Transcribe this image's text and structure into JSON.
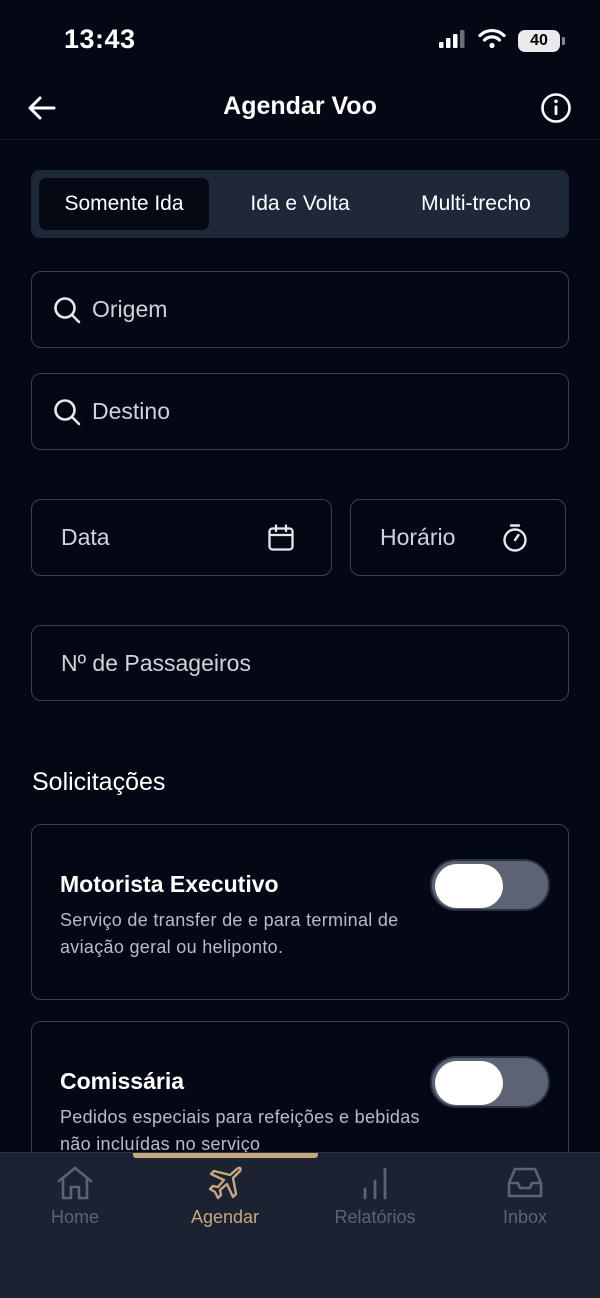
{
  "status": {
    "time": "13:43",
    "battery": "40"
  },
  "header": {
    "title": "Agendar Voo"
  },
  "trip_types": {
    "items": [
      "Somente Ida",
      "Ida e Volta",
      "Multi-trecho"
    ],
    "selected": "Somente Ida"
  },
  "form": {
    "origin_placeholder": "Origem",
    "destination_placeholder": "Destino",
    "date_placeholder": "Data",
    "time_placeholder": "Horário",
    "passengers_placeholder": "Nº de Passageiros"
  },
  "requests": {
    "title": "Solicitações",
    "items": [
      {
        "title": "Motorista Executivo",
        "description": "Serviço de transfer de e para terminal de aviação geral ou heliponto.",
        "enabled": false
      },
      {
        "title": "Comissária",
        "description": "Pedidos especiais para refeições e bebidas não incluídas no serviço",
        "enabled": false
      }
    ]
  },
  "tabbar": {
    "items": [
      {
        "label": "Home",
        "icon": "home-icon"
      },
      {
        "label": "Agendar",
        "icon": "airplane-icon"
      },
      {
        "label": "Relatórios",
        "icon": "bar-chart-icon"
      },
      {
        "label": "Inbox",
        "icon": "inbox-icon"
      }
    ],
    "active": "Agendar"
  },
  "colors": {
    "background": "#040815",
    "accent": "#c7a77f",
    "field_border": "#384052",
    "segment_bg": "#1f2839",
    "tabbar_bg": "#1b2333"
  }
}
